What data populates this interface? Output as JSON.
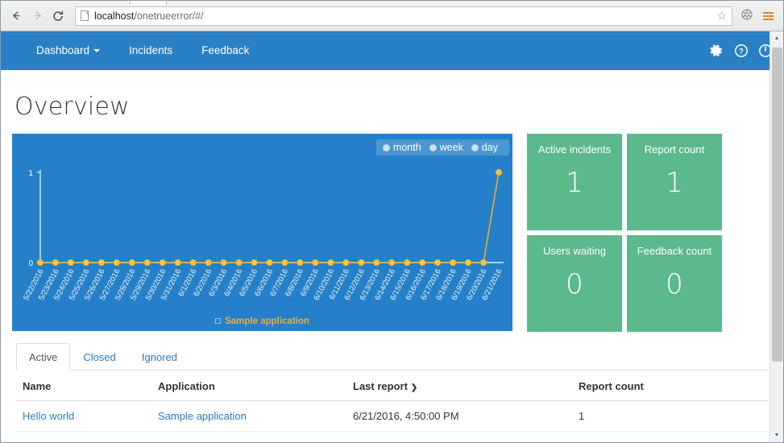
{
  "browser": {
    "back_icon": "back-arrow",
    "forward_icon": "forward-arrow",
    "reload_icon": "reload",
    "url_host": "localhost",
    "url_path": "/onetrueerror/#/",
    "star_icon": "☆",
    "extension_icon": "⬡",
    "menu_icon": "hamburger-menu"
  },
  "navbar": {
    "links": [
      {
        "label": "Dashboard",
        "caret": true
      },
      {
        "label": "Incidents",
        "caret": false
      },
      {
        "label": "Feedback",
        "caret": false
      }
    ],
    "icons": [
      {
        "name": "settings-gear-icon"
      },
      {
        "name": "help-question-icon"
      },
      {
        "name": "power-logout-icon"
      }
    ],
    "background": "#2980c4"
  },
  "page": {
    "title": "Overview"
  },
  "chart_panel": {
    "background": "#2580c9",
    "period_options": [
      {
        "label": "month",
        "selected": true
      },
      {
        "label": "week",
        "selected": false
      },
      {
        "label": "day",
        "selected": false
      }
    ],
    "legend_label": "Sample application",
    "legend_color": "#f0ad2e"
  },
  "chart_data": {
    "type": "line",
    "title": "",
    "xlabel": "",
    "ylabel": "",
    "ylim": [
      0,
      1
    ],
    "yticks": [
      "0",
      "1"
    ],
    "grid": false,
    "legend_position": "bottom",
    "categories": [
      "5/22/2016",
      "5/23/2016",
      "5/24/2016",
      "5/25/2016",
      "5/26/2016",
      "5/27/2016",
      "5/28/2016",
      "5/29/2016",
      "5/30/2016",
      "5/31/2016",
      "6/1/2016",
      "6/2/2016",
      "6/3/2016",
      "6/4/2016",
      "6/5/2016",
      "6/6/2016",
      "6/7/2016",
      "6/8/2016",
      "6/9/2016",
      "6/10/2016",
      "6/11/2016",
      "6/12/2016",
      "6/13/2016",
      "6/14/2016",
      "6/15/2016",
      "6/16/2016",
      "6/17/2016",
      "6/18/2016",
      "6/19/2016",
      "6/20/2016",
      "6/21/2016"
    ],
    "series": [
      {
        "name": "Sample application",
        "color": "#f0ad2e",
        "values": [
          0,
          0,
          0,
          0,
          0,
          0,
          0,
          0,
          0,
          0,
          0,
          0,
          0,
          0,
          0,
          0,
          0,
          0,
          0,
          0,
          0,
          0,
          0,
          0,
          0,
          0,
          0,
          0,
          0,
          0,
          1
        ]
      }
    ]
  },
  "tiles": [
    {
      "label": "Active incidents",
      "value": "1"
    },
    {
      "label": "Report count",
      "value": "1"
    },
    {
      "label": "Users waiting",
      "value": "0"
    },
    {
      "label": "Feedback count",
      "value": "0"
    }
  ],
  "tile_color": "#5cb98b",
  "tabs": [
    {
      "label": "Active",
      "active": true
    },
    {
      "label": "Closed",
      "active": false
    },
    {
      "label": "Ignored",
      "active": false
    }
  ],
  "table": {
    "headers": {
      "name": "Name",
      "application": "Application",
      "last_report": "Last report",
      "sort_caret": "❯",
      "report_count": "Report count"
    },
    "rows": [
      {
        "name": "Hello world",
        "application": "Sample application",
        "last_report": "6/21/2016, 4:50:00 PM",
        "report_count": "1"
      }
    ]
  }
}
